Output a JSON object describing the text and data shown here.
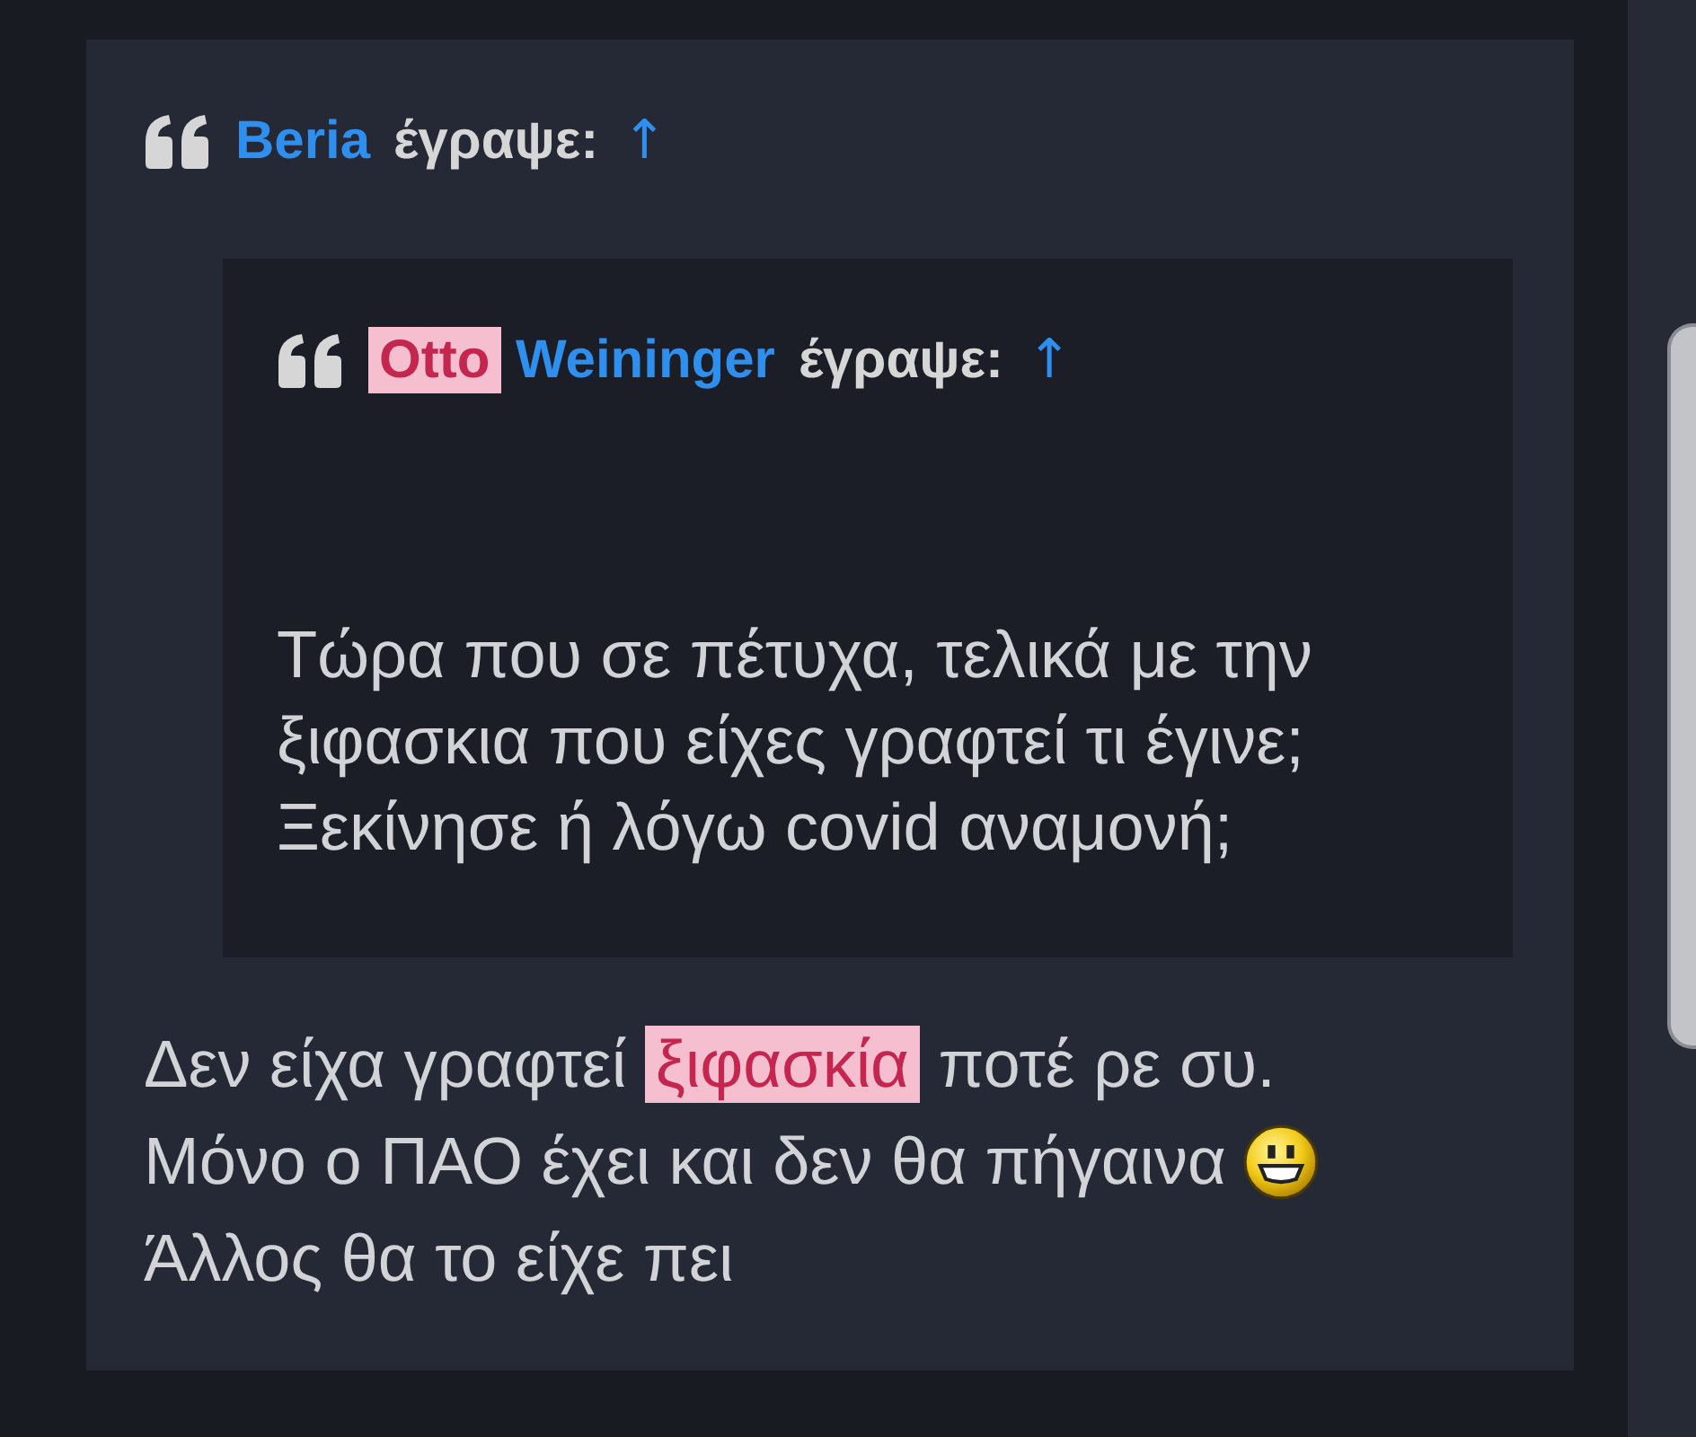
{
  "quote": {
    "author": "Beria",
    "verb": "έγραψε:",
    "jump": "↑",
    "nested_quote": {
      "author": [
        {
          "text": "Otto",
          "highlighted": true
        },
        {
          "text": "Weininger",
          "highlighted": false
        }
      ],
      "verb": "έγραψε:",
      "jump": "↑",
      "lines": [
        "Τώρα που σε πέτυχα, τελικά με την",
        "ξιφασκια που είχες γραφτεί τι έγινε;",
        "Ξεκίνησε ή λόγω covid αναμονή;"
      ]
    }
  },
  "reply": {
    "lines": [
      {
        "segments": [
          {
            "text": "Δεν είχα γραφτεί",
            "highlighted": false
          },
          {
            "text": "ξιφασκία",
            "highlighted": true
          },
          {
            "text": "ποτέ ρε συ.",
            "highlighted": false
          }
        ],
        "emoticon": false
      },
      {
        "segments": [
          {
            "text": "Μόνο ο ΠΑΟ έχει και δεν θα πήγαινα",
            "highlighted": false
          }
        ],
        "emoticon": true
      },
      {
        "segments": [
          {
            "text": "Άλλος θα το είχε πει",
            "highlighted": false
          }
        ],
        "emoticon": false
      }
    ]
  }
}
